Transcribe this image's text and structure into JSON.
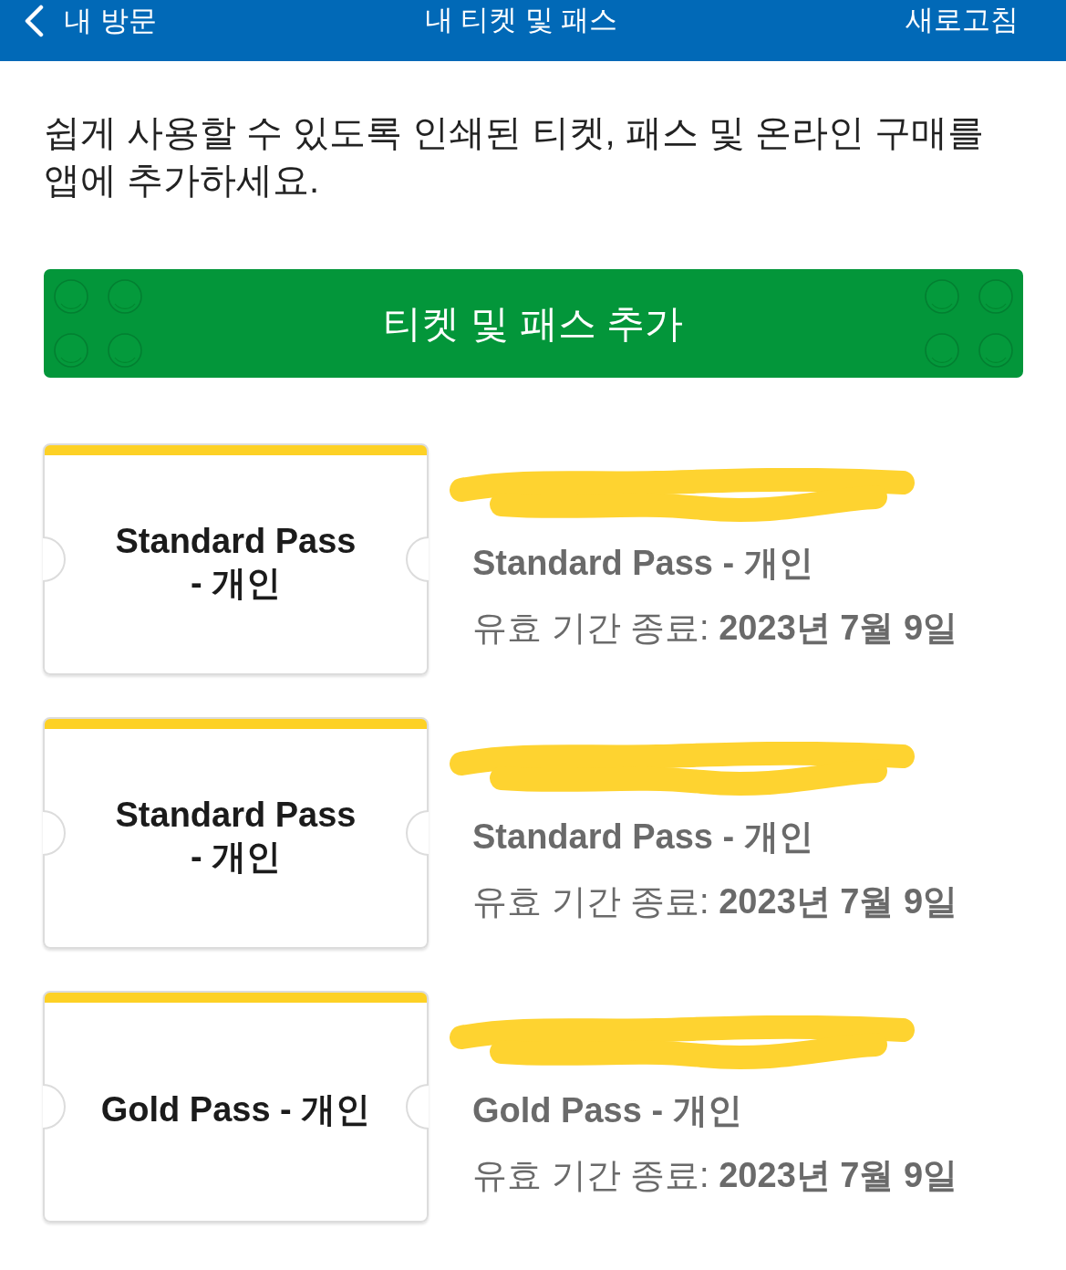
{
  "header": {
    "back_label": "내 방문",
    "title": "내 티켓 및 패스",
    "action": "새로고침"
  },
  "intro": "쉽게 사용할 수 있도록 인쇄된 티켓, 패스 및 온라인 구매를 앱에 추가하세요.",
  "add_button": {
    "label": "티켓 및 패스 추가"
  },
  "passes": [
    {
      "ticket_label": "Standard Pass\n- 개인",
      "name_redacted": true,
      "title": "Standard Pass - 개인",
      "expiry": "유효 기간 종료: **2023년 7월 9일**"
    },
    {
      "ticket_label": "Standard Pass\n- 개인",
      "name_redacted": true,
      "title": "Standard Pass - 개인",
      "expiry": "유효 기간 종료: **2023년 7월 9일**"
    },
    {
      "ticket_label": "Gold Pass - 개인",
      "name_redacted": true,
      "title": "Gold Pass - 개인",
      "expiry": "유효 기간 종료: **2023년 7월 9일**"
    }
  ]
}
